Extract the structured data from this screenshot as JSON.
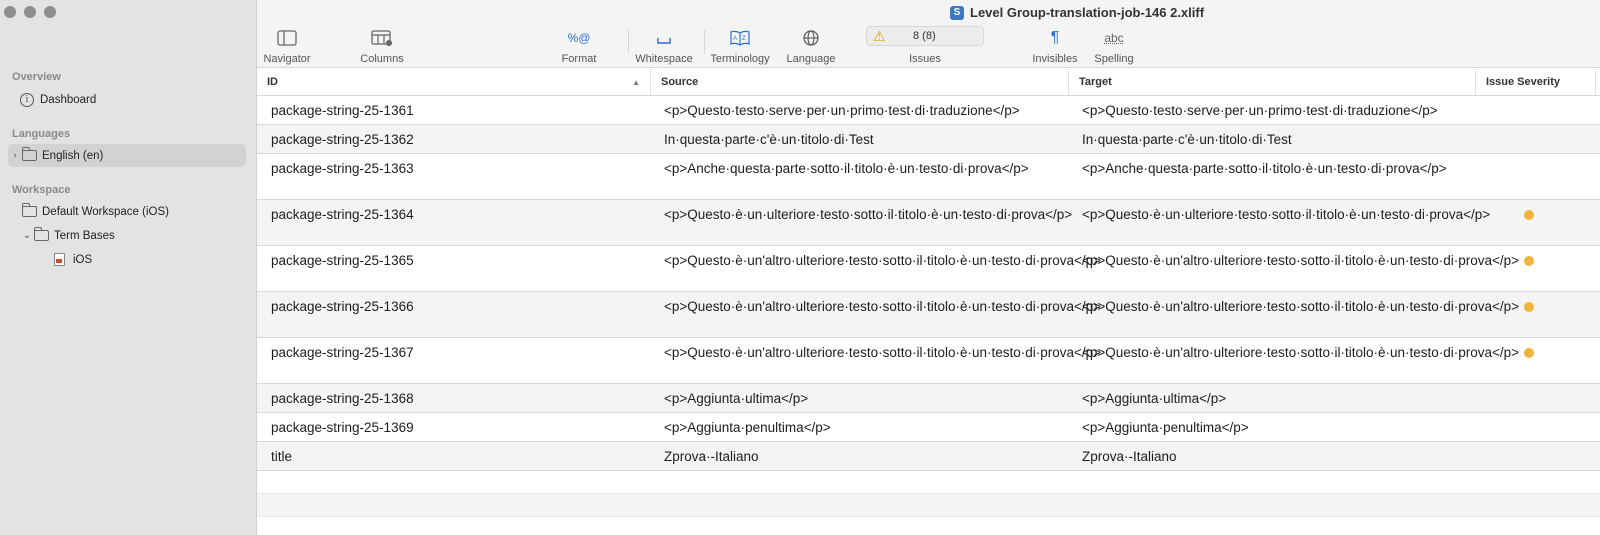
{
  "window": {
    "title": "Level Group-translation-job-146 2.xliff",
    "doc_icon": "S"
  },
  "sidebar": {
    "overview_header": "Overview",
    "dashboard": "Dashboard",
    "languages_header": "Languages",
    "language_item": "English  (en)",
    "workspace_header": "Workspace",
    "workspace_item": "Default Workspace (iOS)",
    "term_bases": "Term Bases",
    "term_base_child": "iOS"
  },
  "toolbar": {
    "navigator": "Navigator",
    "columns": "Columns",
    "format": "Format",
    "format_icon": "%@",
    "whitespace": "Whitespace",
    "terminology": "Terminology",
    "language": "Language",
    "issues": "Issues",
    "issues_count": "8 (8)",
    "invisibles": "Invisibles",
    "spelling": "Spelling",
    "spelling_icon": "abc"
  },
  "table": {
    "columns": [
      "ID",
      "Source",
      "Target",
      "Issue Severity"
    ],
    "rows": [
      {
        "id": "package-string-25-1361",
        "source": "<p>Questo·testo·serve·per·un·primo·test·di·traduzione</p>",
        "target": "<p>Questo·testo·serve·per·un·primo·test·di·traduzione</p>",
        "issue": false
      },
      {
        "id": "package-string-25-1362",
        "source": "In·questa·parte·c'è·un·titolo·di·Test",
        "target": "In·questa·parte·c'è·un·titolo·di·Test",
        "issue": false
      },
      {
        "id": "package-string-25-1363",
        "source": "<p>Anche·questa·parte·sotto·il·titolo·è·un·testo·di·prova</p>",
        "target": "<p>Anche·questa·parte·sotto·il·titolo·è·un·testo·di·prova</p>",
        "issue": false
      },
      {
        "id": "package-string-25-1364",
        "source": "<p>Questo·è·un·ulteriore·testo·sotto·il·titolo·è·un·testo·di·prova</p>",
        "target": "<p>Questo·è·un·ulteriore·testo·sotto·il·titolo·è·un·testo·di·prova</p>",
        "issue": true
      },
      {
        "id": "package-string-25-1365",
        "source": "<p>Questo·è·un'altro·ulteriore·testo·sotto·il·titolo·è·un·testo·di·prova</p>",
        "target": "<p>Questo·è·un'altro·ulteriore·testo·sotto·il·titolo·è·un·testo·di·prova</p>",
        "issue": true
      },
      {
        "id": "package-string-25-1366",
        "source": "<p>Questo·è·un'altro·ulteriore·testo·sotto·il·titolo·è·un·testo·di·prova</p>",
        "target": "<p>Questo·è·un'altro·ulteriore·testo·sotto·il·titolo·è·un·testo·di·prova</p>",
        "issue": true
      },
      {
        "id": "package-string-25-1367",
        "source": "<p>Questo·è·un'altro·ulteriore·testo·sotto·il·titolo·è·un·testo·di·prova</p>",
        "target": "<p>Questo·è·un'altro·ulteriore·testo·sotto·il·titolo·è·un·testo·di·prova</p>",
        "issue": true
      },
      {
        "id": "package-string-25-1368",
        "source": "<p>Aggiunta·ultima</p>",
        "target": "<p>Aggiunta·ultima</p>",
        "issue": false
      },
      {
        "id": "package-string-25-1369",
        "source": "<p>Aggiunta·penultima</p>",
        "target": "<p>Aggiunta·penultima</p>",
        "issue": false
      },
      {
        "id": "title",
        "source": "Zprova·-Italiano",
        "target": "Zprova·-Italiano",
        "issue": false
      }
    ]
  },
  "colors": {
    "accent": "#2f6fd6",
    "warning": "#f0b43a",
    "sidebar_bg": "#e3e3e3"
  }
}
